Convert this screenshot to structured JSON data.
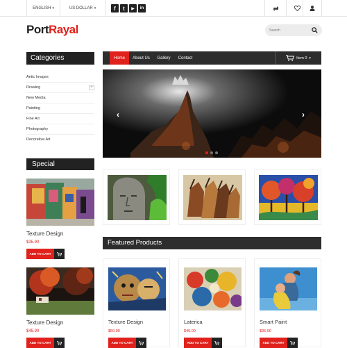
{
  "topbar": {
    "language": "ENGLISH",
    "currency": "US DOLLAR",
    "social": [
      "f",
      "t",
      "▶",
      "in"
    ],
    "icons": [
      "compare-icon",
      "heart-icon",
      "user-icon"
    ]
  },
  "logo": {
    "part1": "Port",
    "part2": "Rayal"
  },
  "search": {
    "placeholder": "Search"
  },
  "categories": {
    "title": "Categories",
    "items": [
      "Antic Images",
      "Drawing",
      "New Media",
      "Painting",
      "Fine Art",
      "Photography",
      "Decorative Art"
    ]
  },
  "special": {
    "title": "Special",
    "items": [
      {
        "name": "Texture Design",
        "price": "$35.90",
        "button": "ADD TO CART"
      },
      {
        "name": "Texture Design",
        "price": "$45.90",
        "button": "ADD TO CART"
      }
    ]
  },
  "nav": {
    "items": [
      "Home",
      "About Us",
      "Gallery",
      "Contact"
    ],
    "active": "Home",
    "cart": "Item 0"
  },
  "slider": {
    "prev": "‹",
    "next": "›"
  },
  "featured": {
    "title": "Featured Products",
    "items": [
      {
        "name": "Texture Design",
        "price": "$50.90",
        "button": "ADD TO CART"
      },
      {
        "name": "Laterica",
        "price": "$40.00",
        "button": "ADD TO CART"
      },
      {
        "name": "Smart Paint",
        "price": "$35.90",
        "button": "ADD TO CART"
      }
    ]
  },
  "colors": {
    "accent": "#e0211c",
    "dark": "#2d2d2d"
  }
}
